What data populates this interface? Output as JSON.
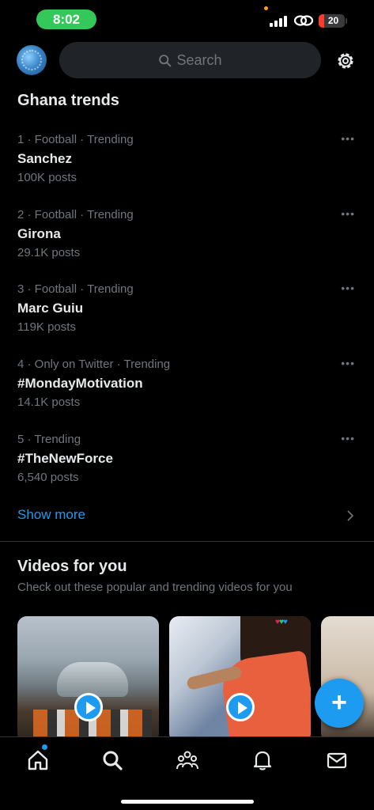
{
  "status_bar": {
    "time": "8:02",
    "battery": "20"
  },
  "header": {
    "search_placeholder": "Search"
  },
  "trends": {
    "title": "Ghana trends",
    "items": [
      {
        "meta": "1 · Football · Trending",
        "name": "Sanchez",
        "posts": "100K posts"
      },
      {
        "meta": "2 · Football · Trending",
        "name": "Girona",
        "posts": "29.1K posts"
      },
      {
        "meta": "3 · Football · Trending",
        "name": "Marc Guiu",
        "posts": "119K posts"
      },
      {
        "meta": "4 · Only on Twitter · Trending",
        "name": "#MondayMotivation",
        "posts": "14.1K posts"
      },
      {
        "meta": "5 · Trending",
        "name": "#TheNewForce",
        "posts": "6,540 posts"
      }
    ],
    "show_more": "Show more"
  },
  "videos": {
    "title": "Videos for you",
    "subtitle": "Check out these popular and trending videos for you"
  },
  "icons": {
    "search": "search-icon",
    "settings": "gear-icon",
    "more": "more-horizontal-icon",
    "play": "play-icon",
    "compose": "plus-icon",
    "home": "home-icon",
    "explore": "search-icon",
    "communities": "people-icon",
    "notifications": "bell-icon",
    "messages": "mail-icon"
  },
  "colors": {
    "accent": "#1d9bf0",
    "background": "#000000",
    "secondary_text": "#71767b",
    "status_time_pill": "#34c759"
  }
}
